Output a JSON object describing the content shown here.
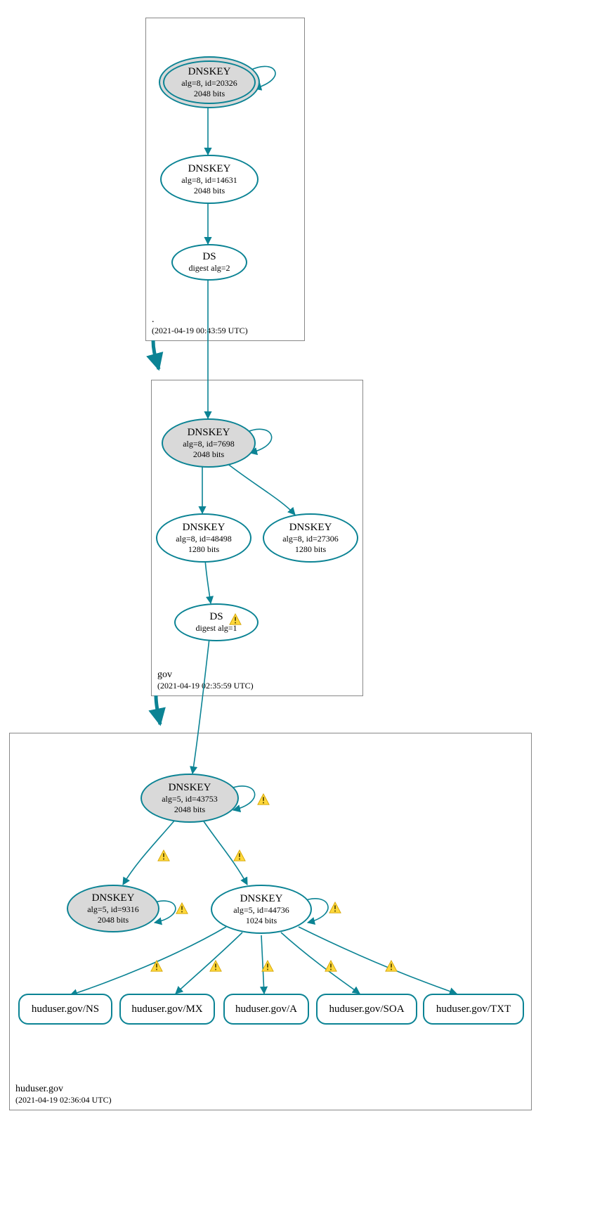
{
  "zones": {
    "root": {
      "name": ".",
      "ts": "(2021-04-19 00:43:59 UTC)"
    },
    "gov": {
      "name": "gov",
      "ts": "(2021-04-19 02:35:59 UTC)"
    },
    "hud": {
      "name": "huduser.gov",
      "ts": "(2021-04-19 02:36:04 UTC)"
    }
  },
  "nodes": {
    "root_ksk": {
      "l1": "DNSKEY",
      "l2": "alg=8, id=20326",
      "l3": "2048 bits"
    },
    "root_zsk": {
      "l1": "DNSKEY",
      "l2": "alg=8, id=14631",
      "l3": "2048 bits"
    },
    "root_ds": {
      "l1": "DS",
      "l2": "digest alg=2"
    },
    "gov_ksk": {
      "l1": "DNSKEY",
      "l2": "alg=8, id=7698",
      "l3": "2048 bits"
    },
    "gov_zsk": {
      "l1": "DNSKEY",
      "l2": "alg=8, id=48498",
      "l3": "1280 bits"
    },
    "gov_zsk2": {
      "l1": "DNSKEY",
      "l2": "alg=8, id=27306",
      "l3": "1280 bits"
    },
    "gov_ds": {
      "l1": "DS",
      "l2": "digest alg=1"
    },
    "hud_ksk": {
      "l1": "DNSKEY",
      "l2": "alg=5, id=43753",
      "l3": "2048 bits"
    },
    "hud_ksk2": {
      "l1": "DNSKEY",
      "l2": "alg=5, id=9316",
      "l3": "2048 bits"
    },
    "hud_zsk": {
      "l1": "DNSKEY",
      "l2": "alg=5, id=44736",
      "l3": "1024 bits"
    },
    "rr_ns": {
      "l1": "huduser.gov/NS"
    },
    "rr_mx": {
      "l1": "huduser.gov/MX"
    },
    "rr_a": {
      "l1": "huduser.gov/A"
    },
    "rr_soa": {
      "l1": "huduser.gov/SOA"
    },
    "rr_txt": {
      "l1": "huduser.gov/TXT"
    }
  }
}
